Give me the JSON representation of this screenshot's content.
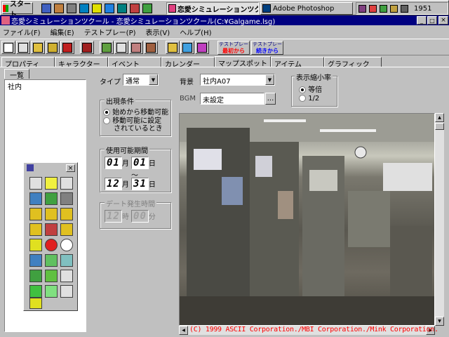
{
  "taskbar": {
    "start": "スタート",
    "task1": "恋愛シミュレーションツク...",
    "task2": "Adobe Photoshop",
    "clock": "1951"
  },
  "window": {
    "title": "恋愛シミュレーションツクール - 恋愛シミュレーションツクール(C:¥Galgame.lsg)"
  },
  "menu": [
    "ファイル(F)",
    "編集(E)",
    "テストプレー(P)",
    "表示(V)",
    "ヘルプ(H)"
  ],
  "toolbar": {
    "test_start_top": "テストプレー",
    "test_start_bottom": "最初から",
    "test_cont_top": "テストプレー",
    "test_cont_bottom": "続きから"
  },
  "tabs": [
    "プロパティ",
    "キャラクター",
    "イベント",
    "カレンダー",
    "マップスポット",
    "アイテム",
    "グラフィック"
  ],
  "left_panel": {
    "tab": "一覧",
    "items": [
      "社内"
    ]
  },
  "form": {
    "type_label": "タイプ",
    "type_value": "通常",
    "bg_label": "背景",
    "bg_value": "社内A07",
    "bgm_label": "BGM",
    "bgm_value": "未設定",
    "bgm_button": "...",
    "scale_group": "表示縮小率",
    "scale_opt1": "等倍",
    "scale_opt2": "1/2",
    "appear_group": "出現条件",
    "appear_opt1": "始めから移動可能",
    "appear_opt2_l1": "移動可能に設定",
    "appear_opt2_l2": "されているとき",
    "period_group": "使用可能期間",
    "from_month": "01",
    "from_day": "01",
    "month_unit": "月",
    "day_unit": "日",
    "tilde": "～",
    "to_month": "12",
    "to_day": "31",
    "date_group": "デート発生時間",
    "date_hour": "12",
    "hour_unit": "時",
    "date_min": "00",
    "min_unit": "分"
  },
  "copyright": "(C) 1999 ASCII Corporation./MBI Corporation./Mink Corporation.",
  "colors": {
    "titlebar": "#000080",
    "accent_red": "#ff0000"
  }
}
